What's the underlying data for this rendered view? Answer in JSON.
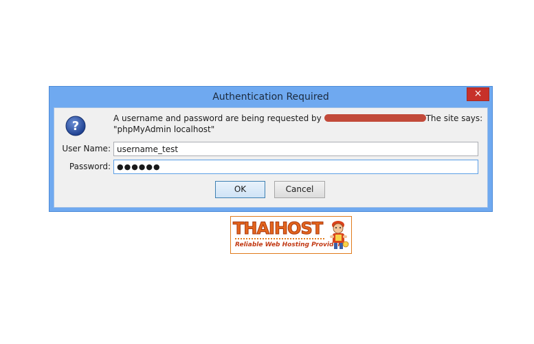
{
  "dialog": {
    "title": "Authentication Required",
    "close_label": "×",
    "icon": "question-icon",
    "message_prefix": "A username and password are being requested by",
    "message_suffix": "The site says:",
    "message_line2": "\"phpMyAdmin localhost\"",
    "fields": {
      "username_label": "User Name:",
      "username_value": "username_test",
      "password_label": "Password:",
      "password_value": "●●●●●●"
    },
    "buttons": {
      "ok_label": "OK",
      "cancel_label": "Cancel"
    },
    "colors": {
      "frame": "#6fa9f0",
      "close": "#c7312a",
      "redaction": "#c24a3a"
    }
  },
  "logo": {
    "wordmark": "THAIHOST",
    "tagline": "Reliable Web Hosting Provider",
    "accent": "#e3651d"
  }
}
